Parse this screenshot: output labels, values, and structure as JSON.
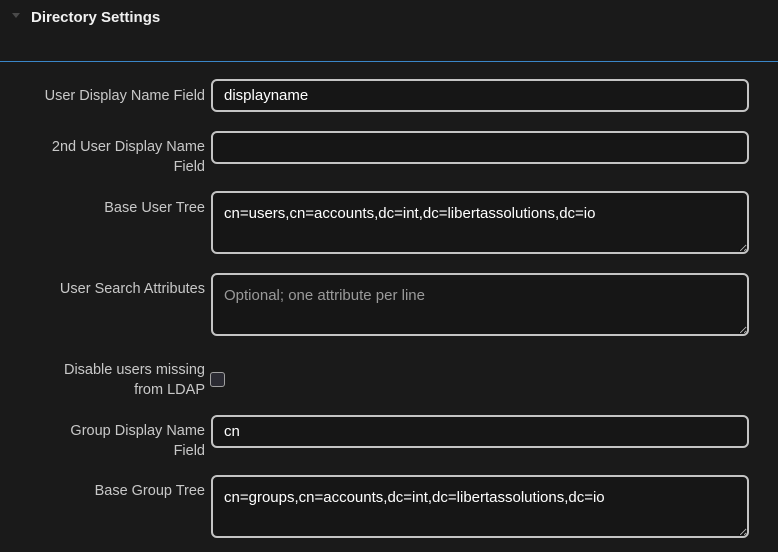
{
  "section": {
    "title": "Directory Settings"
  },
  "fields": {
    "user_display_name": {
      "label": "User Display Name Field",
      "value": "displayname"
    },
    "second_user_display_name": {
      "label_line1": "2nd User Display Name",
      "label_line2": "Field",
      "value": ""
    },
    "base_user_tree": {
      "label": "Base User Tree",
      "value": "cn=users,cn=accounts,dc=int,dc=libertassolutions,dc=io"
    },
    "user_search_attributes": {
      "label": "User Search Attributes",
      "value": "",
      "placeholder": "Optional; one attribute per line"
    },
    "disable_missing_users": {
      "label_line1": "Disable users missing",
      "label_line2": "from LDAP",
      "checked": false
    },
    "group_display_name": {
      "label_line1": "Group Display Name",
      "label_line2": "Field",
      "value": "cn"
    },
    "base_group_tree": {
      "label": "Base Group Tree",
      "value": "cn=groups,cn=accounts,dc=int,dc=libertassolutions,dc=io"
    }
  },
  "icons": {
    "section_toggle": "triangle-down-icon"
  },
  "colors": {
    "background": "#1a1a1a",
    "divider": "#3a86c8",
    "field_border": "#c4c4c4",
    "label_text": "#c8c8c8"
  }
}
